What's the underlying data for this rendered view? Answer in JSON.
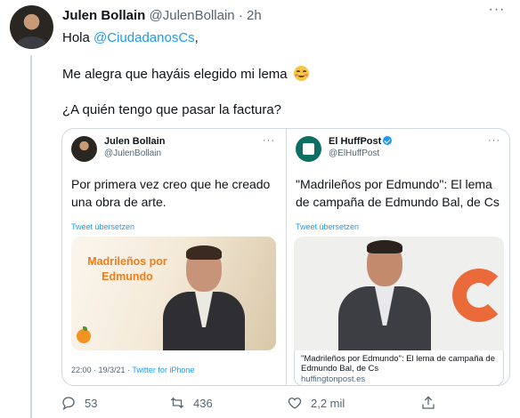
{
  "tweet": {
    "author_name": "Julen Bollain",
    "author_handle": "@JulenBollain",
    "separator": "·",
    "time": "2h",
    "greeting_prefix": "Hola ",
    "mention": "@CiudadanosCs",
    "greeting_suffix": ",",
    "line2": "Me alegra que hayáis elegido mi lema",
    "line2_emoji": "smiling-face-with-blush-emoji",
    "line3": "¿A quién tengo que pasar la factura?"
  },
  "screenshot_left": {
    "author_name": "Julen Bollain",
    "author_handle": "@JulenBollain",
    "text": "Por primera vez creo que he creado una obra de arte.",
    "translate": "Tweet übersetzen",
    "image_slogan": "Madrileños por\nEdmundo",
    "time": "22:00 · 19/3/21 · ",
    "source": "Twitter for iPhone"
  },
  "screenshot_right": {
    "author_name": "El HuffPost",
    "author_handle": "@ElHuffPost",
    "text": "\"Madrileños por Edmundo\": El lema de campaña de Edmundo Bal, de Cs",
    "translate": "Tweet übersetzen",
    "link_title": "\"Madrileños por Edmundo\": El lema de campaña de Edmundo Bal, de Cs",
    "link_domain": "huffingtonpost.es"
  },
  "actions": {
    "replies": "53",
    "retweets": "436",
    "likes": "2,2 mil"
  },
  "colors": {
    "accent": "#1d9bf0",
    "text": "#0f1419",
    "muted": "#536471",
    "border": "#cfd9de",
    "orange": "#f07d1c"
  }
}
